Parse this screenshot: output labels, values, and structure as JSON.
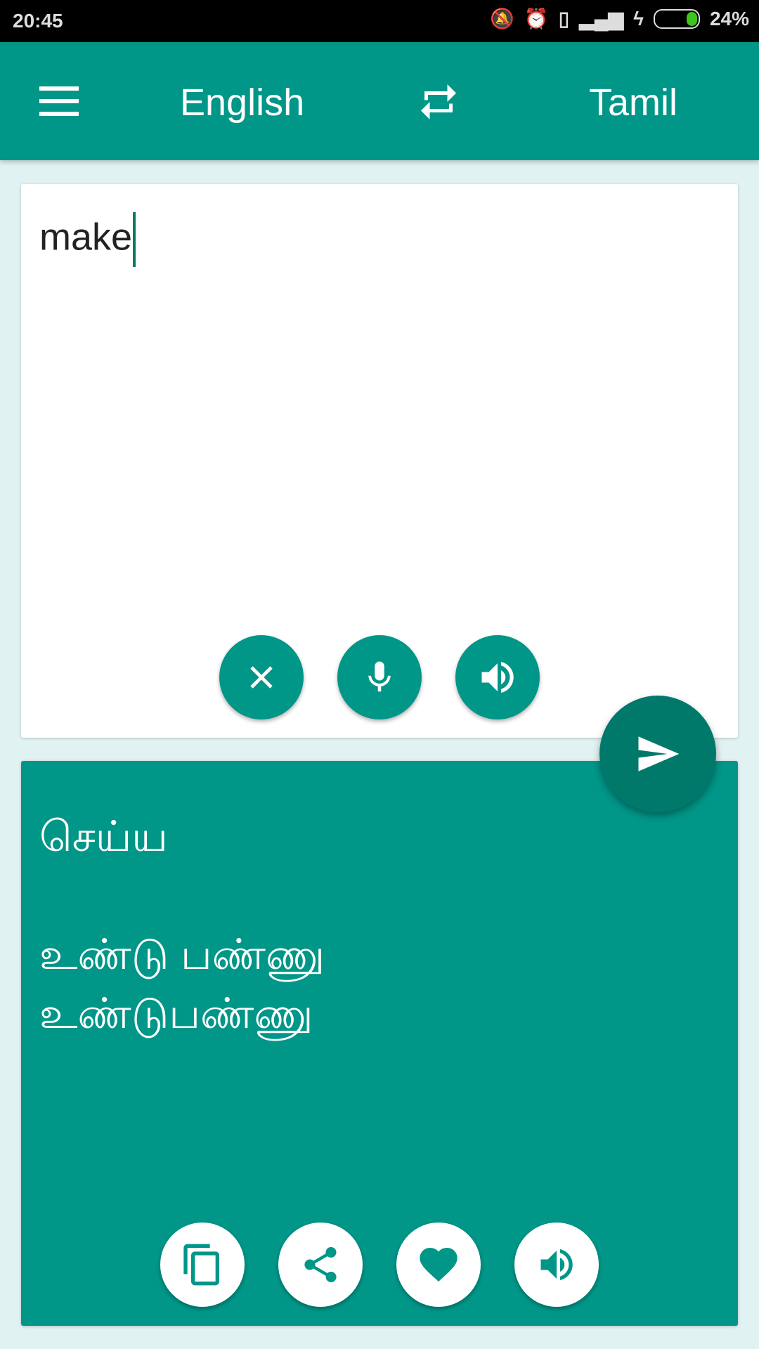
{
  "status_bar": {
    "time": "20:45",
    "battery": "24%",
    "battery_level": 24,
    "icons": [
      "bell-off-icon",
      "alarm-icon",
      "usb-icon",
      "signal-icon",
      "charging-icon",
      "battery-icon"
    ]
  },
  "app_bar": {
    "source_language": "English",
    "target_language": "Tamil",
    "icons": [
      "menu-icon",
      "swap-icon"
    ]
  },
  "input": {
    "value": "make",
    "buttons": [
      "clear-icon",
      "mic-icon",
      "speaker-icon"
    ]
  },
  "translate_button": {
    "icon": "send-icon"
  },
  "output": {
    "text": "செய்ய\n\nஉண்டு பண்ணு\nஉண்டுபண்ணு",
    "buttons": [
      "copy-icon",
      "share-icon",
      "heart-icon",
      "speaker-icon"
    ]
  },
  "colors": {
    "primary": "#009688",
    "primary_dark": "#00796b",
    "background": "#e0f2f1"
  }
}
